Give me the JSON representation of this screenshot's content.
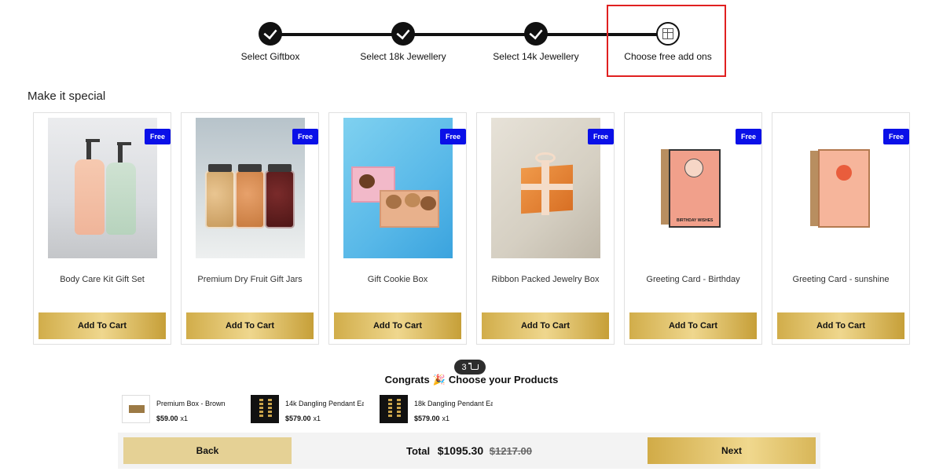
{
  "stepper": {
    "steps": [
      {
        "label": "Select Giftbox",
        "state": "done"
      },
      {
        "label": "Select 18k Jewellery",
        "state": "done"
      },
      {
        "label": "Select 14k Jewellery",
        "state": "done"
      },
      {
        "label": "Choose free add ons",
        "state": "current"
      }
    ],
    "highlight_color": "#e02020"
  },
  "section": {
    "title": "Make it special"
  },
  "products": [
    {
      "title": "Body Care Kit Gift Set",
      "badge": "Free",
      "button": "Add To Cart"
    },
    {
      "title": "Premium Dry Fruit Gift Jars",
      "badge": "Free",
      "button": "Add To Cart"
    },
    {
      "title": "Gift Cookie Box",
      "badge": "Free",
      "button": "Add To Cart"
    },
    {
      "title": "Ribbon Packed Jewelry Box",
      "badge": "Free",
      "button": "Add To Cart"
    },
    {
      "title": "Greeting Card - Birthday",
      "badge": "Free",
      "button": "Add To Cart"
    },
    {
      "title": "Greeting Card - sunshine",
      "badge": "Free",
      "button": "Add To Cart"
    }
  ],
  "cart": {
    "count": "3",
    "icon": "cart-icon"
  },
  "congrats": {
    "text": "Congrats",
    "emoji": "🎉",
    "subtext": "Choose your Products"
  },
  "selected_items": [
    {
      "name": "Premium Box - Brown",
      "price": "$59.00",
      "qty": "x1"
    },
    {
      "name": "14k Dangling Pendant Ea...",
      "price": "$579.00",
      "qty": "x1"
    },
    {
      "name": "18k Dangling Pendant Ea...",
      "price": "$579.00",
      "qty": "x1"
    }
  ],
  "footer": {
    "back_label": "Back",
    "next_label": "Next",
    "total_label": "Total",
    "total_amount": "$1095.30",
    "original_amount": "$1217.00"
  },
  "colors": {
    "badge": "#0a10e8",
    "gold": "#d1ad4a"
  }
}
